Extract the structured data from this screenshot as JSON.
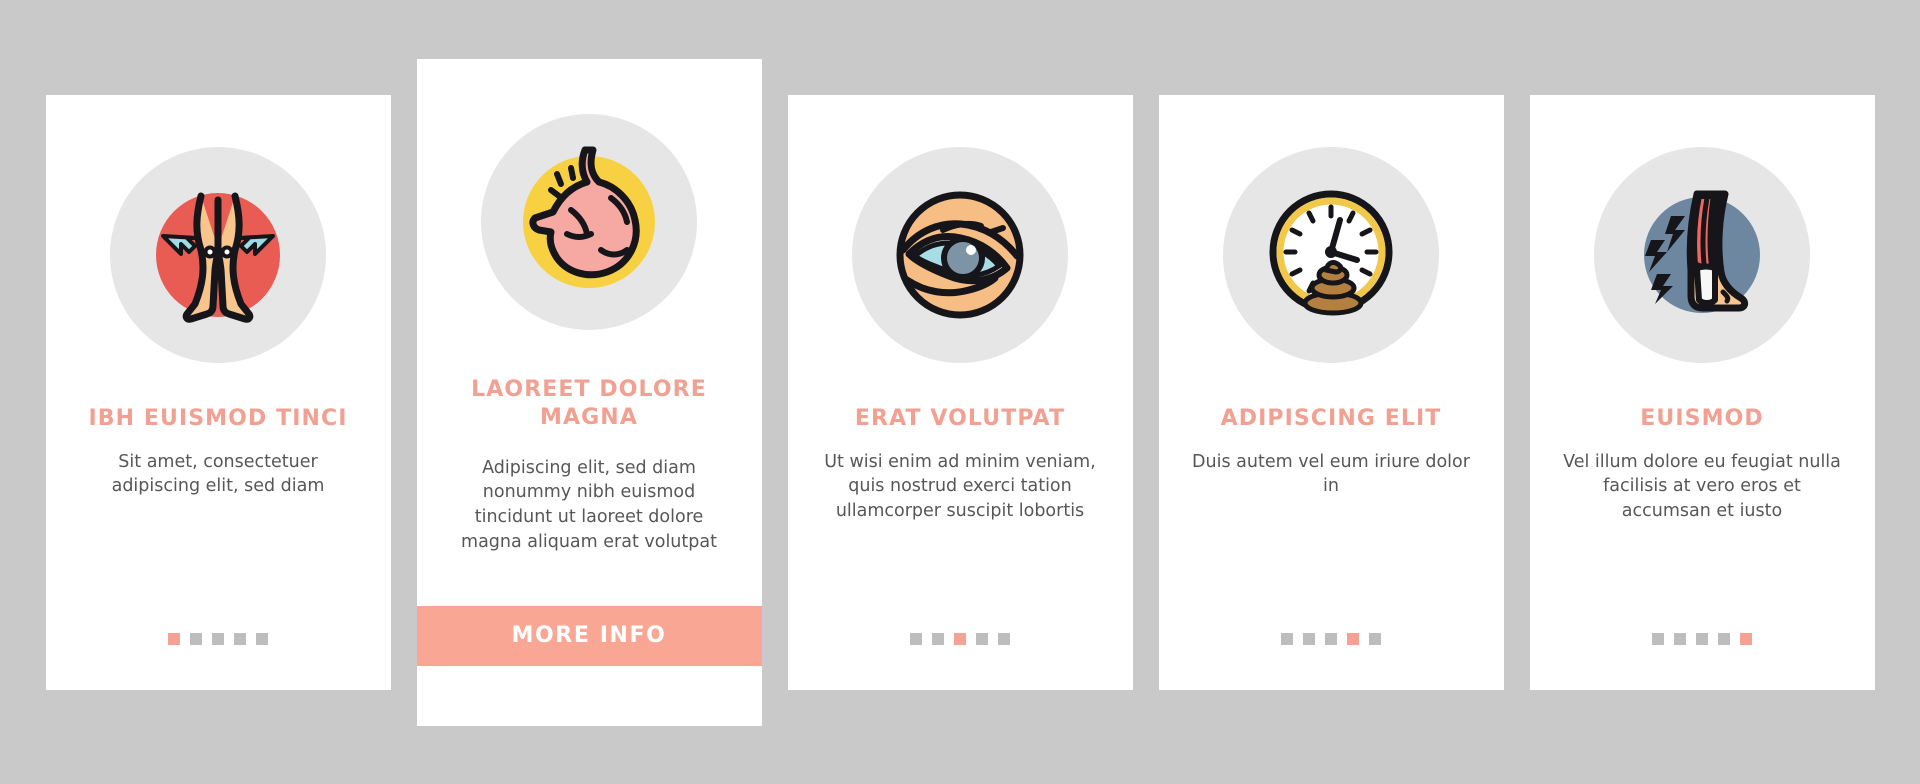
{
  "theme": {
    "page_background": "#c9c9c9",
    "card_background": "#ffffff",
    "accent": "#f2a091",
    "button_background": "#f9a695",
    "body_text": "#575757",
    "icon_circle": "#e6e6e6",
    "dot_inactive": "#bdbdbd",
    "dot_active": "#f3a293"
  },
  "cards": [
    {
      "icon_name": "knee-pain-legs-icon",
      "icon_circle_color": "#e85c54",
      "title": "IBH EUISMOD TINCI",
      "body": "Sit amet, consectetuer adipiscing elit, sed diam",
      "pager": {
        "total": 5,
        "active": 1
      },
      "featured": false
    },
    {
      "icon_name": "stomach-pain-icon",
      "icon_circle_color": "#f7d141",
      "title": "LAOREET DOLORE MAGNA",
      "body": "Adipiscing elit, sed diam nonummy nibh euismod tincidunt ut laoreet dolore magna aliquam erat volutpat",
      "pager": {
        "total": 5,
        "active": 2
      },
      "featured": true,
      "button_label": "MORE INFO"
    },
    {
      "icon_name": "eye-vision-icon",
      "icon_circle_color": "#f6bd84",
      "title": "ERAT VOLUTPAT",
      "body": "Ut wisi enim ad minim veniam, quis nostrud exerci tation ullamcorper suscipit lobortis",
      "pager": {
        "total": 5,
        "active": 3
      },
      "featured": false
    },
    {
      "icon_name": "clock-stool-icon",
      "icon_circle_color": "#ffffff",
      "title": "ADIPISCING ELIT",
      "body": "Duis autem vel eum iriure dolor in",
      "pager": {
        "total": 5,
        "active": 4
      },
      "featured": false
    },
    {
      "icon_name": "leg-muscle-pain-icon",
      "icon_circle_color": "#6e87a0",
      "title": "EUISMOD",
      "body": "Vel illum dolore eu feugiat nulla facilisis at vero eros et accumsan et iusto",
      "pager": {
        "total": 5,
        "active": 5
      },
      "featured": false
    }
  ]
}
